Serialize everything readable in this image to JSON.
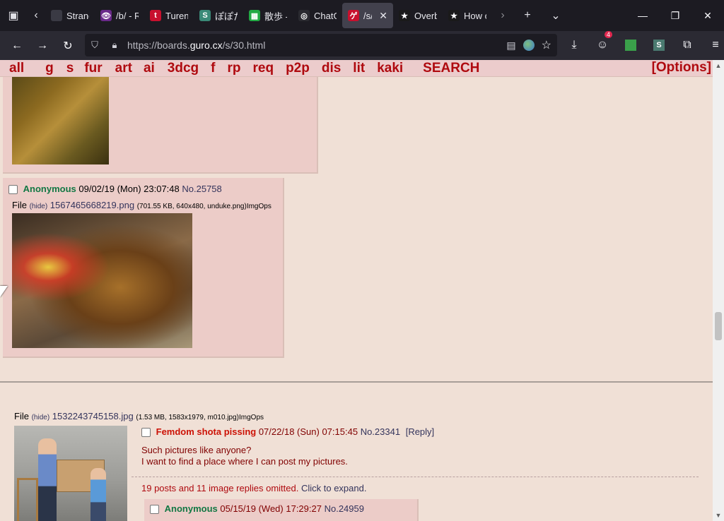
{
  "browser": {
    "tabs": [
      {
        "title": "Strange",
        "fav_color": "#3a3a44",
        "fav_glyph": ""
      },
      {
        "title": "/b/ - R",
        "fav_color": "#6a2a8a",
        "fav_glyph": "👁"
      },
      {
        "title": "Turen",
        "fav_color": "#c8102e",
        "fav_glyph": "t"
      },
      {
        "title": "ぽぽた",
        "fav_color": "#3a8a78",
        "fav_glyph": "S"
      },
      {
        "title": "散歩 -",
        "fav_color": "#22aa44",
        "fav_glyph": "▦"
      },
      {
        "title": "ChatG",
        "fav_color": "#2a2a30",
        "fav_glyph": "◎"
      },
      {
        "title": "/s/",
        "fav_color": "#c8102e",
        "fav_glyph": "ゲ",
        "active": true
      },
      {
        "title": "Overb",
        "fav_color": "#1a1a1a",
        "fav_glyph": "★"
      },
      {
        "title": "How c",
        "fav_color": "#1a1a1a",
        "fav_glyph": "★"
      }
    ],
    "url_prefix": "https://boards.",
    "url_domain": "guro.cx",
    "url_path": "/s/30.html",
    "badge_count": "4"
  },
  "boardnav": {
    "links": [
      "all",
      "g",
      "s",
      "fur",
      "art",
      "ai",
      "3dcg",
      "f",
      "rp",
      "req",
      "p2p",
      "dis",
      "lit",
      "kaki"
    ],
    "search": "SEARCH",
    "options": "[Options]"
  },
  "post1": {
    "name": "Anonymous",
    "date": "09/02/19 (Mon) 23:07:48",
    "no": "No.25758",
    "file_label": "File",
    "hide": "(hide)",
    "filename": "1567465668219.png",
    "fileinfo": "(701.55 KB, 640x480, unduke.png)",
    "imgops": "ImgOps"
  },
  "thread": {
    "file_label": "File",
    "hide": "(hide)",
    "filename": "1532243745158.jpg",
    "fileinfo": "(1.53 MB, 1583x1979, m010.jpg)",
    "imgops": "ImgOps",
    "subject": "Femdom shota pissing",
    "date": "07/22/18 (Sun) 07:15:45",
    "no": "No.23341",
    "reply": "[Reply]",
    "body_line1": "Such pictures like anyone?",
    "body_line2": "I want to find a place where I can post my pictures.",
    "omitted": "19 posts and 11 image replies omitted.",
    "expand": "Click to expand."
  },
  "post2": {
    "name": "Anonymous",
    "date": "05/15/19 (Wed) 17:29:27",
    "no": "No.24959"
  }
}
